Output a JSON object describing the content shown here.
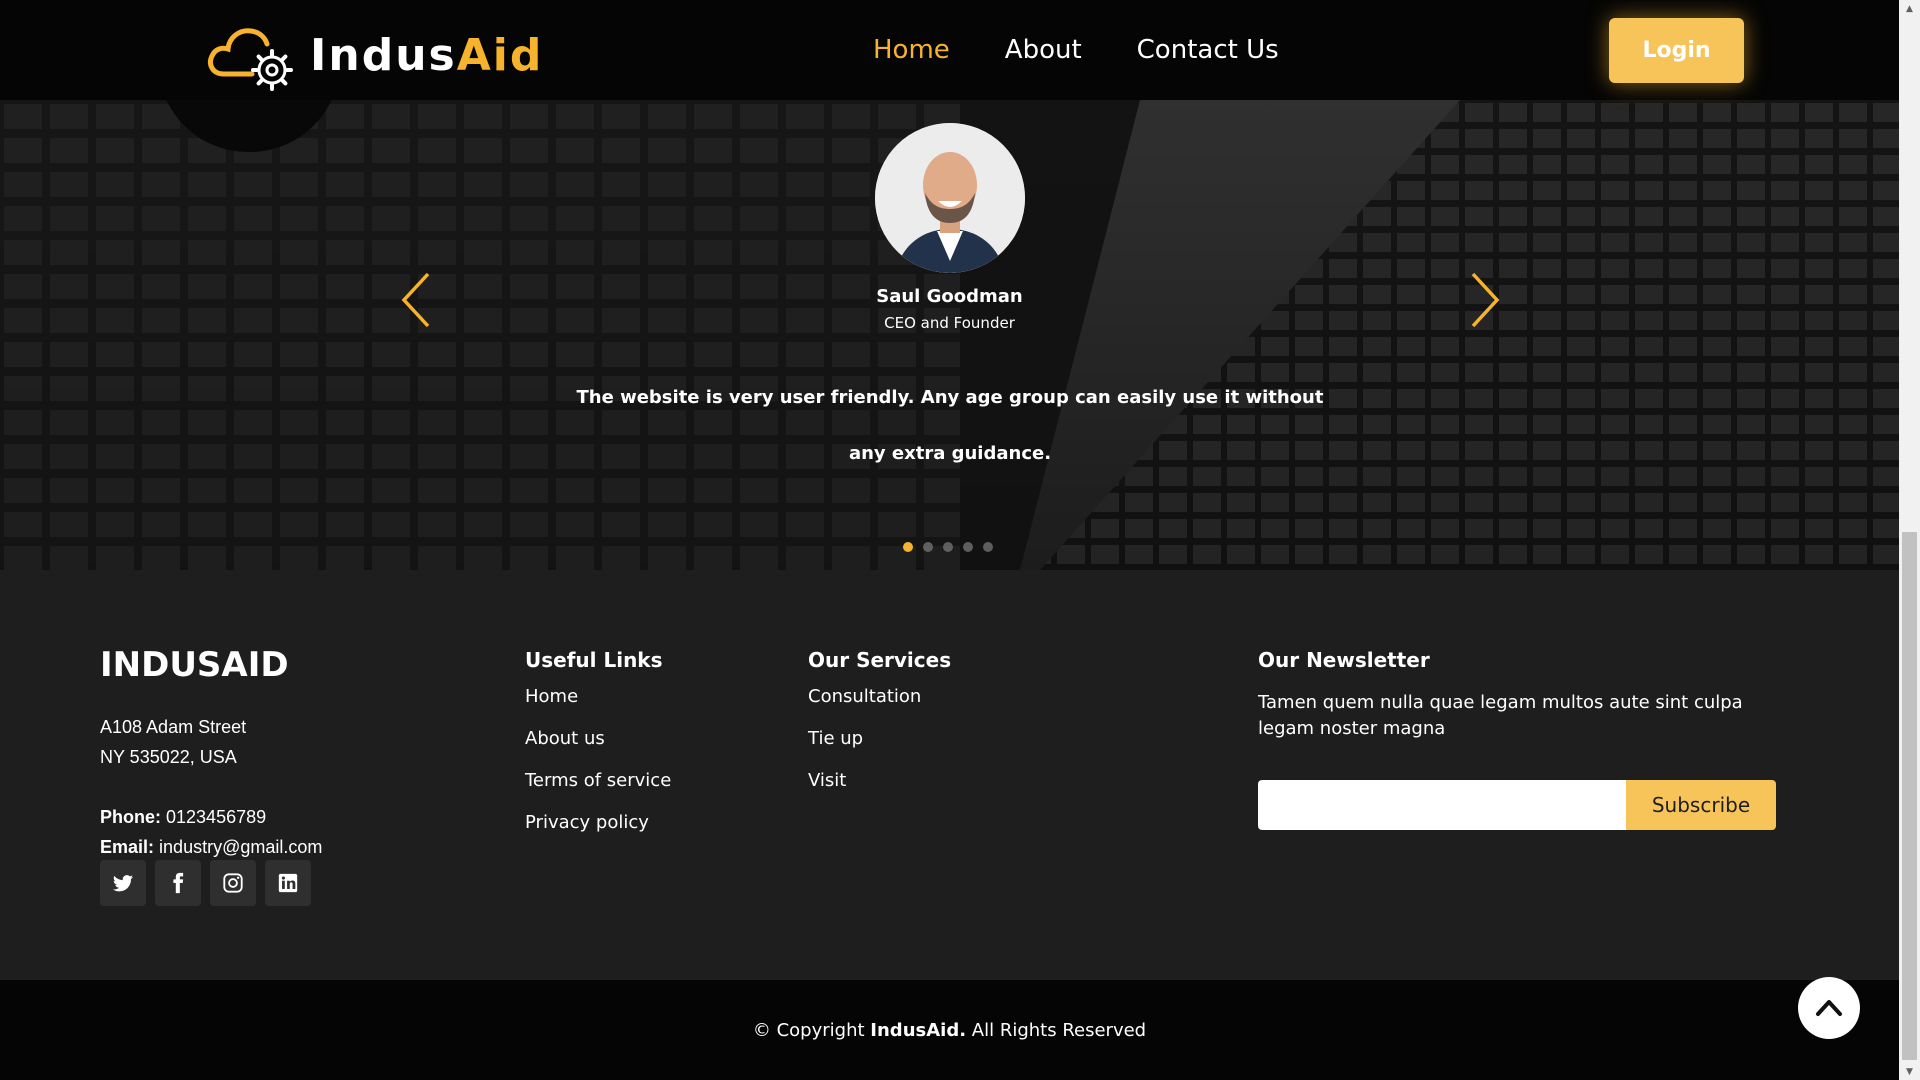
{
  "header": {
    "brand_primary": "Indus",
    "brand_accent": "Aid",
    "nav": [
      {
        "label": "Home",
        "active": true
      },
      {
        "label": "About",
        "active": false
      },
      {
        "label": "Contact Us",
        "active": false
      }
    ],
    "login_label": "Login",
    "accent_color": "#f7b32b"
  },
  "testimonial": {
    "name": "Saul Goodman",
    "role": "CEO and Founder",
    "quote": "The website is very user friendly. Any age group can easily use it without any extra guidance.",
    "slide_count": 5,
    "active_slide": 1,
    "prev_icon": "chevron-left-icon",
    "next_icon": "chevron-right-icon"
  },
  "footer": {
    "brand": "INDUSAID",
    "address_line1": "A108 Adam Street",
    "address_line2": "NY 535022, USA",
    "phone_label": "Phone:",
    "phone": "0123456789",
    "email_label": "Email:",
    "email": "industry@gmail.com",
    "socials": [
      "twitter-icon",
      "facebook-icon",
      "instagram-icon",
      "linkedin-icon"
    ],
    "useful_links": {
      "title": "Useful Links",
      "items": [
        "Home",
        "About us",
        "Terms of service",
        "Privacy policy"
      ]
    },
    "services": {
      "title": "Our Services",
      "items": [
        "Consultation",
        "Tie up",
        "Visit"
      ]
    },
    "newsletter": {
      "title": "Our Newsletter",
      "text": "Tamen quem nulla quae legam multos aute sint culpa legam noster magna",
      "input_value": "",
      "button_label": "Subscribe"
    },
    "copyright_prefix": "© Copyright",
    "copyright_brand": "IndusAid.",
    "copyright_suffix": "All Rights Reserved"
  }
}
